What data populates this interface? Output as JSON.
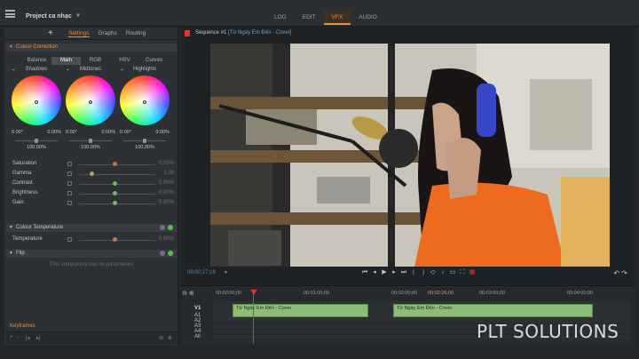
{
  "app": {
    "project_name": "Project ca nhạc",
    "modes": [
      "LOG",
      "EDIT",
      "VFX",
      "AUDIO"
    ],
    "active_mode": "VFX"
  },
  "left_panel": {
    "tabs": [
      "Settings",
      "Graphs",
      "Routing"
    ],
    "active_tab": "Settings",
    "colour_correction": {
      "title": "Colour Correction",
      "sub_tabs": [
        "Balance",
        "Main",
        "RGB",
        "HSV",
        "Curves"
      ],
      "active_sub_tab": "Main",
      "wheels": [
        {
          "label": "Shadows",
          "left_val": "0.00°",
          "right_val": "0.00%",
          "pct": "100.00%"
        },
        {
          "label": "Midtones",
          "left_val": "0.00°",
          "right_val": "0.00%",
          "pct": "100.00%"
        },
        {
          "label": "Highlights",
          "left_val": "0.00°",
          "right_val": "0.00%",
          "pct": "100.00%"
        }
      ],
      "adjustments": [
        {
          "label": "Saturation",
          "value": "0.00%"
        },
        {
          "label": "Gamma",
          "value": "1.00"
        },
        {
          "label": "Contrast",
          "value": "0.00%"
        },
        {
          "label": "Brightness",
          "value": "0.00%"
        },
        {
          "label": "Gain",
          "value": "0.00%"
        }
      ]
    },
    "colour_temperature": {
      "title": "Colour Temperature",
      "adjustments": [
        {
          "label": "Temperature",
          "value": "0.00%"
        }
      ]
    },
    "flip": {
      "title": "Flip",
      "message": "This component has no parameters"
    },
    "keyframes_label": "Keyframes"
  },
  "viewer": {
    "sequence_label": "Sequence #1",
    "sequence_clip": "[Từ Ngày Em Đến - Cover]",
    "timecode": "00:00:27;18"
  },
  "timeline": {
    "ruler_ticks": [
      "00:00:00;00",
      "00:01:00;00",
      "00:02:00;00",
      "00:02:26;00",
      "00:03:00;00",
      "00:04:00;00"
    ],
    "tracks": [
      "V1",
      "A1",
      "A2",
      "A3",
      "A4",
      "All"
    ],
    "clips": [
      "Từ Ngày Em Đến - Cover",
      "Từ Ngày Em Đến - Cover"
    ]
  },
  "watermark": "PLT SOLUTIONS",
  "colors": {
    "accent": "#f58b34",
    "timecode": "#4d88c8",
    "clip": "#8dbb78",
    "playhead": "#d53a2c"
  }
}
